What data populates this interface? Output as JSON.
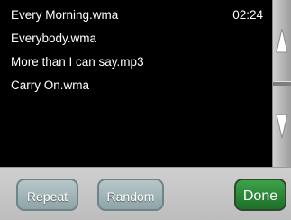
{
  "playlist": {
    "tracks": [
      {
        "name": "Every Morning.wma",
        "duration": "02:24"
      },
      {
        "name": "Everybody.wma",
        "duration": ""
      },
      {
        "name": "More than I can say.mp3",
        "duration": ""
      },
      {
        "name": "Carry On.wma",
        "duration": ""
      }
    ]
  },
  "scrollbar": {
    "up_icon": "triangle-up-icon",
    "down_icon": "triangle-down-icon"
  },
  "controls": {
    "repeat_label": "Repeat",
    "random_label": "Random",
    "done_label": "Done"
  },
  "colors": {
    "list_background": "#000000",
    "text": "#ffffff",
    "done_button": "#2e8b3a",
    "grey_button": "#a4b6b8"
  }
}
